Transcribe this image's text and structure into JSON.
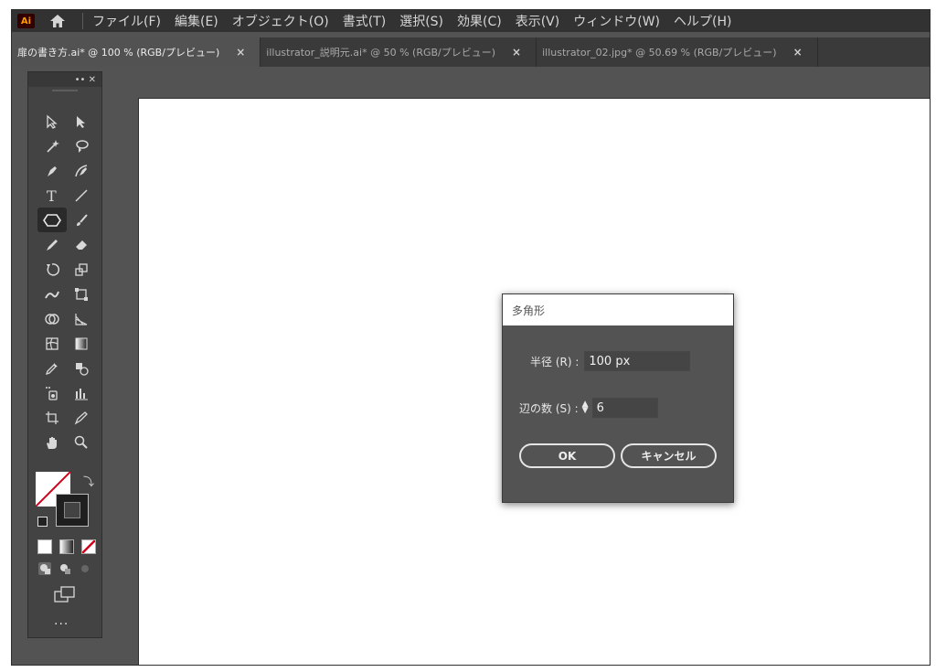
{
  "app": {
    "logo": "Ai",
    "home_icon": "home-icon"
  },
  "menu": [
    "ファイル(F)",
    "編集(E)",
    "オブジェクト(O)",
    "書式(T)",
    "選択(S)",
    "効果(C)",
    "表示(V)",
    "ウィンドウ(W)",
    "ヘルプ(H)"
  ],
  "tabs": [
    {
      "label": "扉の書き方.ai* @ 100 % (RGB/プレビュー)",
      "close": "×",
      "active": true
    },
    {
      "label": "illustrator_説明元.ai* @ 50 % (RGB/プレビュー)",
      "close": "×",
      "active": false
    },
    {
      "label": "illustrator_02.jpg* @ 50.69 % (RGB/プレビュー)",
      "close": "×",
      "active": false
    }
  ],
  "toolbox": {
    "header_icons": [
      "collapse-icon",
      "close-icon"
    ],
    "header_text": "•• ✕",
    "tools": [
      [
        "selection-tool-icon",
        "direct-selection-tool-icon"
      ],
      [
        "magic-wand-tool-icon",
        "lasso-tool-icon"
      ],
      [
        "pen-tool-icon",
        "curvature-tool-icon"
      ],
      [
        "type-tool-icon",
        "line-segment-tool-icon"
      ],
      [
        "polygon-tool-icon",
        "paintbrush-tool-icon"
      ],
      [
        "pencil-tool-icon",
        "eraser-tool-icon"
      ],
      [
        "rotate-tool-icon",
        "scale-tool-icon"
      ],
      [
        "warp-tool-icon",
        "free-transform-tool-icon"
      ],
      [
        "shape-builder-tool-icon",
        "perspective-grid-tool-icon"
      ],
      [
        "mesh-tool-icon",
        "gradient-tool-icon"
      ],
      [
        "eyedropper-tool-icon",
        "blend-tool-icon"
      ],
      [
        "symbol-sprayer-tool-icon",
        "column-graph-tool-icon"
      ],
      [
        "artboard-tool-icon",
        "slice-tool-icon"
      ],
      [
        "hand-tool-icon",
        "zoom-tool-icon"
      ]
    ],
    "selected_tool": "polygon-tool-icon",
    "more": "···"
  },
  "dialog": {
    "title": "多角形",
    "radius_label": "半径 (R) :",
    "radius_value": "100 px",
    "sides_label": "辺の数 (S) :",
    "sides_value": "6",
    "ok_label": "OK",
    "cancel_label": "キャンセル"
  },
  "colors": {
    "menubar": "#323232",
    "workspace": "#535353",
    "accent_none": "#d0021b",
    "logo_orange": "#ff9a00"
  }
}
